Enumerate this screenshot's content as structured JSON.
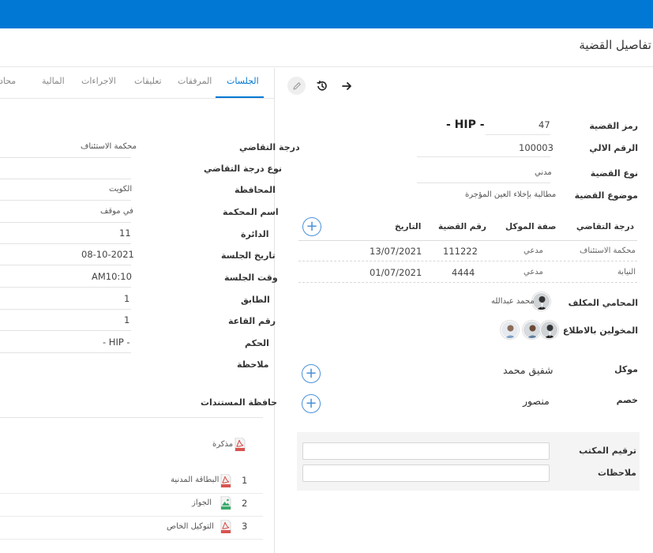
{
  "header": {
    "title": "تفاصيل القضية"
  },
  "tabs": [
    {
      "label": "الجلسات"
    },
    {
      "label": "المرفقات"
    },
    {
      "label": "تعليقات"
    },
    {
      "label": "الاجراءات"
    },
    {
      "label": "المالية"
    },
    {
      "label": "محادثة"
    }
  ],
  "case": {
    "number_label": "رمز القضية",
    "number_value": "47",
    "number_code": "- HIP -",
    "auto_label": "الرقم الالي",
    "auto_value": "100003",
    "type_label": "نوع القضية",
    "type_value": "مدني",
    "subject_label": "موضوع القضية",
    "subject_value": "مطالبة بإخلاء العين المؤجرة"
  },
  "degrees_table": {
    "headers": [
      "درجة التقاضي",
      "صفة الموكل",
      "رقم القضية",
      "التاريخ"
    ],
    "rows": [
      [
        "محكمة الاستئناف",
        "مدعي",
        "111222",
        "13/07/2021"
      ],
      [
        "النيابة",
        "مدعي",
        "4444",
        "01/07/2021"
      ]
    ]
  },
  "people": {
    "lawyer_label": "المحامي المكلف",
    "lawyer_name": "محمد عبدالله",
    "authorized_label": "المخولين بالاطلاع",
    "client_label": "موكل",
    "client_name": "شفيق محمد",
    "opponent_label": "خصم",
    "opponent_name": "منصور"
  },
  "office": {
    "numbering_label": "ترقيم المكتب",
    "notes_label": "ملاحظات",
    "numbering_value": "",
    "notes_value": ""
  },
  "session": {
    "degree_label": "درجة التقاضي",
    "degree_value": "محكمة الاستئناف",
    "degree_type_label": "نوع درجة التقاضي",
    "degree_type_value": "",
    "governorate_label": "المحافظة",
    "governorate_value": "الكويت",
    "court_label": "اسم المحكمة",
    "court_value": "في موقف",
    "circuit_label": "الدائرة",
    "circuit_value": "11",
    "date_label": "تاريخ الجلسة",
    "date_value": "08-10-2021",
    "time_label": "وقت الجلسة",
    "time_value": "AM10:10",
    "floor_label": "الطابق",
    "floor_value": "1",
    "room_label": "رقم القاعة",
    "room_value": "1",
    "ruling_label": "الحكم",
    "ruling_value": "- HIP -",
    "note_label": "ملاحظة",
    "note_value": ""
  },
  "documents": {
    "title": "حافظة المستندات",
    "memo": "مذكرة",
    "items": [
      {
        "num": "1",
        "name": "البطاقة المدنية",
        "icon": "pdf-icon"
      },
      {
        "num": "2",
        "name": "الجواز",
        "icon": "image-file-icon"
      },
      {
        "num": "3",
        "name": "التوكيل الخاص",
        "icon": "pdf-icon"
      }
    ]
  },
  "colors": {
    "brand": "#0078d4",
    "plus": "#4a90d9",
    "pdf": "#d9534f"
  }
}
